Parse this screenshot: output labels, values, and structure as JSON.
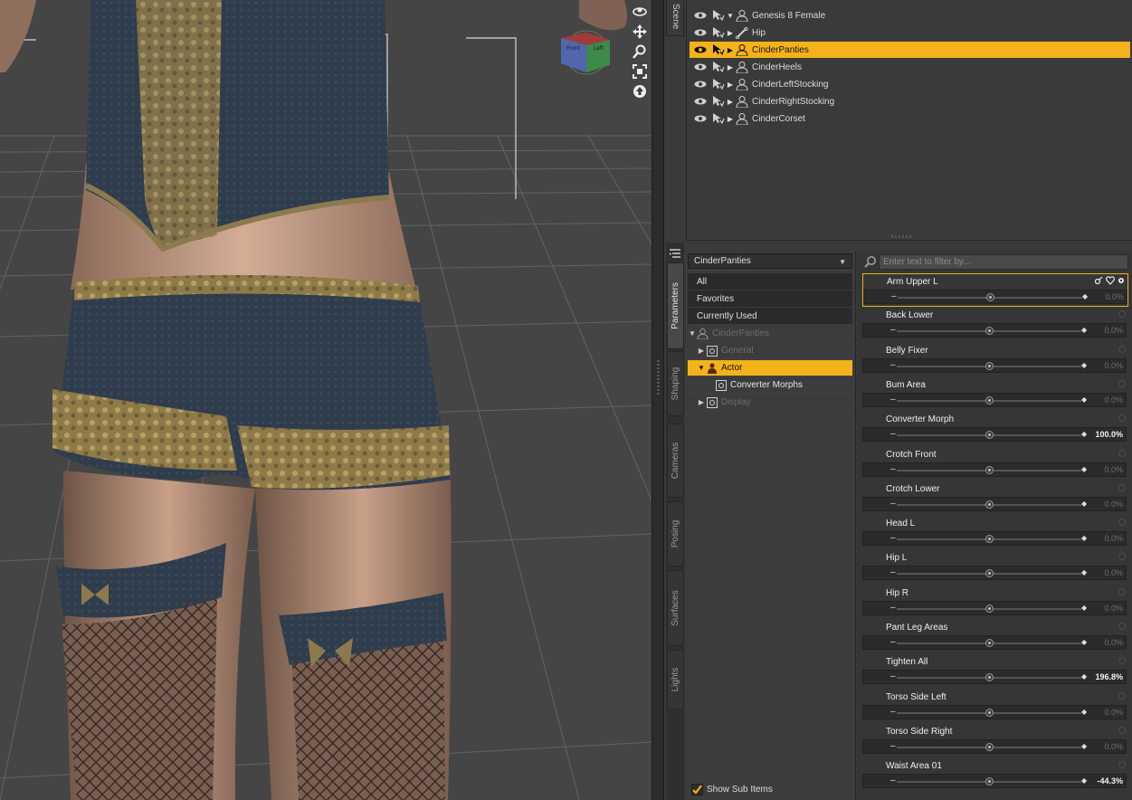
{
  "scene": {
    "tab_label": "Scene",
    "nodes": [
      {
        "label": "Genesis 8 Female",
        "expanded": true,
        "icon": "figure-icon",
        "selected": false
      },
      {
        "label": "Hip",
        "expanded": false,
        "icon": "bone-icon",
        "selected": false
      },
      {
        "label": "CinderPanties",
        "expanded": false,
        "icon": "figure-icon",
        "selected": true
      },
      {
        "label": "CinderHeels",
        "expanded": false,
        "icon": "figure-icon",
        "selected": false
      },
      {
        "label": "CinderLeftStocking",
        "expanded": false,
        "icon": "figure-icon",
        "selected": false
      },
      {
        "label": "CinderRightStocking",
        "expanded": false,
        "icon": "figure-icon",
        "selected": false
      },
      {
        "label": "CinderCorset",
        "expanded": false,
        "icon": "figure-icon",
        "selected": false
      }
    ]
  },
  "side_tabs": [
    "Parameters",
    "Shaping",
    "Cameras",
    "Posing",
    "Surfaces",
    "Lights"
  ],
  "active_side_tab": "Parameters",
  "node_dropdown": {
    "value": "CinderPanties"
  },
  "filters": [
    "All",
    "Favorites",
    "Currently Used"
  ],
  "groups": [
    {
      "label": "CinderPanties",
      "indent": 0,
      "arrow": "▼",
      "icon": "figure-icon",
      "style": "dim"
    },
    {
      "label": "General",
      "indent": 1,
      "arrow": "▶",
      "icon": "group-icon",
      "style": "dim"
    },
    {
      "label": "Actor",
      "indent": 1,
      "arrow": "▼",
      "icon": "actor-icon",
      "style": "selected"
    },
    {
      "label": "Converter Morphs",
      "indent": 2,
      "arrow": "",
      "icon": "group-icon",
      "style": "light"
    },
    {
      "label": "Display",
      "indent": 1,
      "arrow": "▶",
      "icon": "group-icon",
      "style": "dim"
    }
  ],
  "show_sub_items": {
    "label": "Show Sub Items",
    "checked": true
  },
  "filter": {
    "placeholder": "Enter text to filter by..."
  },
  "parameters": [
    {
      "name": "Arm Upper L",
      "value": "0.0%",
      "level": 0.5,
      "active": true
    },
    {
      "name": "Back Lower",
      "value": "0.0%",
      "level": 0.5
    },
    {
      "name": "Belly Fixer",
      "value": "0.0%",
      "level": 0.5
    },
    {
      "name": "Bum Area",
      "value": "0.0%",
      "level": 0.5
    },
    {
      "name": "Converter Morph",
      "value": "100.0%",
      "level": 0.5,
      "nonzero": true
    },
    {
      "name": "Crotch Front",
      "value": "0.0%",
      "level": 0.5
    },
    {
      "name": "Crotch Lower",
      "value": "0.0%",
      "level": 0.5
    },
    {
      "name": "Head L",
      "value": "0.0%",
      "level": 0.5
    },
    {
      "name": "Hip L",
      "value": "0.0%",
      "level": 0.5
    },
    {
      "name": "Hip R",
      "value": "0.0%",
      "level": 0.5
    },
    {
      "name": "Pant Leg Areas",
      "value": "0.0%",
      "level": 0.5
    },
    {
      "name": "Tighten All",
      "value": "196.8%",
      "level": 0.5,
      "nonzero": true
    },
    {
      "name": "Torso Side Left",
      "value": "0.0%",
      "level": 0.5
    },
    {
      "name": "Torso Side Right",
      "value": "0.0%",
      "level": 0.5
    },
    {
      "name": "Waist Area 01",
      "value": "-44.3%",
      "level": 0.5,
      "nonzero": true
    }
  ],
  "viewport": {
    "cube_labels": [
      "Front",
      "Left"
    ],
    "tools": [
      "orbit-icon",
      "pan-icon",
      "zoom-icon",
      "frame-icon",
      "reset-icon"
    ]
  },
  "colors": {
    "selection": "#f4b21b",
    "panel": "#3a3a3a",
    "viewport_bg": "#444444"
  }
}
